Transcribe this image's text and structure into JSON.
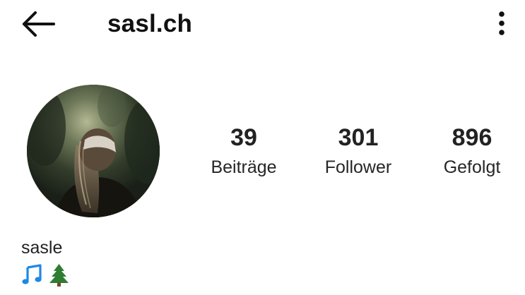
{
  "header": {
    "title": "sasl.ch",
    "back_icon": "arrow-left-icon",
    "menu_icon": "more-vertical-icon"
  },
  "profile": {
    "avatar_icon": "profile-photo",
    "stats": [
      {
        "value": "39",
        "label": "Beiträge"
      },
      {
        "value": "301",
        "label": "Follower"
      },
      {
        "value": "896",
        "label": "Gefolgt"
      }
    ],
    "name": "sasle",
    "bio_emojis": [
      "musical-notes-icon",
      "evergreen-tree-icon"
    ]
  },
  "colors": {
    "text": "#262626",
    "emoji_blue": "#1e88e5",
    "emoji_green": "#2e7d32",
    "background": "#ffffff"
  }
}
